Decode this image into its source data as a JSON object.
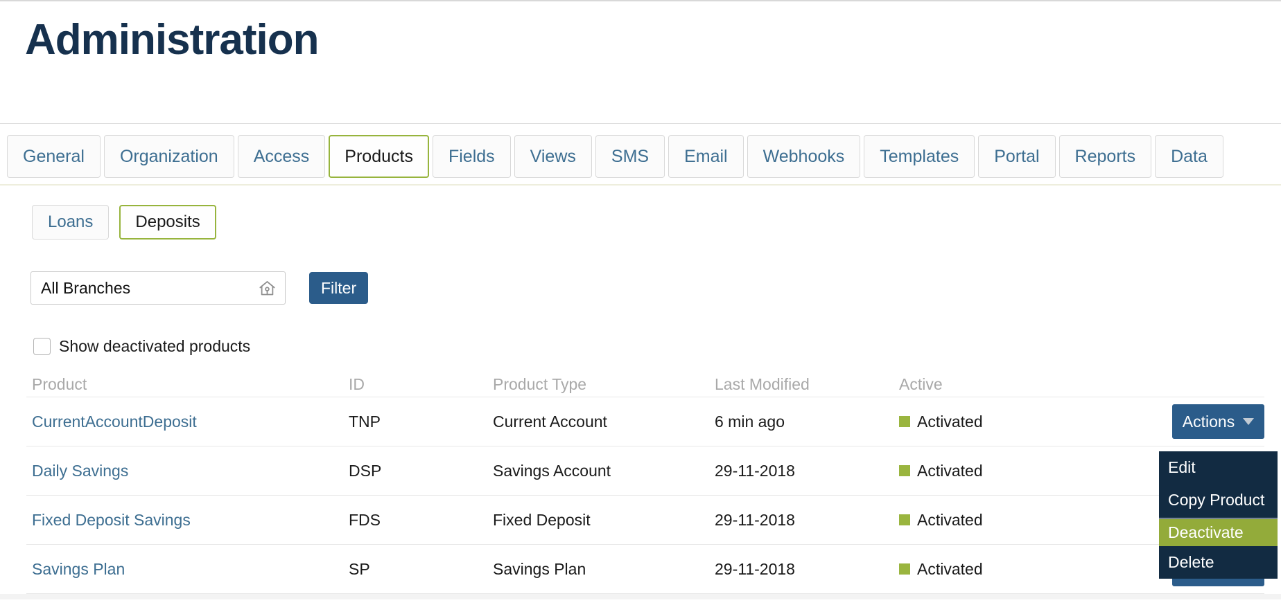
{
  "page": {
    "title": "Administration"
  },
  "tabs": {
    "items": [
      {
        "label": "General",
        "selected": false
      },
      {
        "label": "Organization",
        "selected": false
      },
      {
        "label": "Access",
        "selected": false
      },
      {
        "label": "Products",
        "selected": true
      },
      {
        "label": "Fields",
        "selected": false
      },
      {
        "label": "Views",
        "selected": false
      },
      {
        "label": "SMS",
        "selected": false
      },
      {
        "label": "Email",
        "selected": false
      },
      {
        "label": "Webhooks",
        "selected": false
      },
      {
        "label": "Templates",
        "selected": false
      },
      {
        "label": "Portal",
        "selected": false
      },
      {
        "label": "Reports",
        "selected": false
      },
      {
        "label": "Data",
        "selected": false
      }
    ]
  },
  "subtabs": {
    "items": [
      {
        "label": "Loans",
        "selected": false
      },
      {
        "label": "Deposits",
        "selected": true
      }
    ]
  },
  "filter": {
    "branch_value": "All Branches",
    "branch_icon": "home-icon",
    "button_label": "Filter"
  },
  "show_deactivated": {
    "label": "Show deactivated products",
    "checked": false
  },
  "table": {
    "columns": {
      "product": "Product",
      "id": "ID",
      "type": "Product Type",
      "modified": "Last Modified",
      "active": "Active"
    },
    "actions_label": "Actions",
    "rows": [
      {
        "product": "CurrentAccountDeposit",
        "id": "TNP",
        "type": "Current Account",
        "modified": "6 min ago",
        "active": "Activated"
      },
      {
        "product": "Daily Savings",
        "id": "DSP",
        "type": "Savings Account",
        "modified": "29-11-2018",
        "active": "Activated"
      },
      {
        "product": "Fixed Deposit Savings",
        "id": "FDS",
        "type": "Fixed Deposit",
        "modified": "29-11-2018",
        "active": "Activated"
      },
      {
        "product": "Savings Plan",
        "id": "SP",
        "type": "Savings Plan",
        "modified": "29-11-2018",
        "active": "Activated"
      }
    ]
  },
  "actions_menu": {
    "items": [
      {
        "label": "Edit",
        "highlighted": false
      },
      {
        "label": "Copy Product",
        "highlighted": false
      },
      {
        "label": "Deactivate",
        "highlighted": true
      },
      {
        "label": "Delete",
        "highlighted": false
      }
    ]
  },
  "colors": {
    "title_navy": "#16314e",
    "link_blue": "#3d6e91",
    "accent_green_border": "#97b43d",
    "status_green": "#9ab53f",
    "button_blue": "#2b5c8a",
    "menu_background": "#122b42",
    "menu_highlight_green": "#93ab3a"
  }
}
